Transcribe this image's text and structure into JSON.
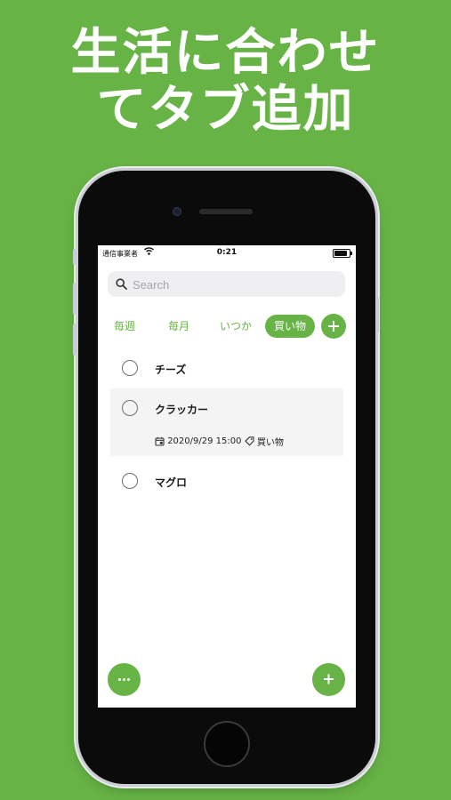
{
  "headline": {
    "line1": "生活に合わせ",
    "line2": "てタブ追加"
  },
  "status_bar": {
    "carrier": "通信事業者",
    "time": "0:21",
    "battery_level": 0.9
  },
  "search": {
    "placeholder": "Search",
    "value": ""
  },
  "tabs": [
    {
      "label": "毎週",
      "active": false
    },
    {
      "label": "毎月",
      "active": false
    },
    {
      "label": "いつか",
      "active": false
    },
    {
      "label": "買い物",
      "active": true
    }
  ],
  "todos": [
    {
      "title": "チーズ",
      "done": false
    },
    {
      "title": "クラッカー",
      "done": false,
      "due": "2020/9/29 15:00",
      "tag": "買い物"
    },
    {
      "title": "マグロ",
      "done": false
    }
  ],
  "colors": {
    "accent": "#67b346",
    "background": "#67b346",
    "row_highlight": "#f4f4f5"
  },
  "icons": [
    "search-icon",
    "wifi-icon",
    "battery-icon",
    "plus-icon",
    "calendar-icon",
    "tag-icon",
    "more-icon"
  ]
}
